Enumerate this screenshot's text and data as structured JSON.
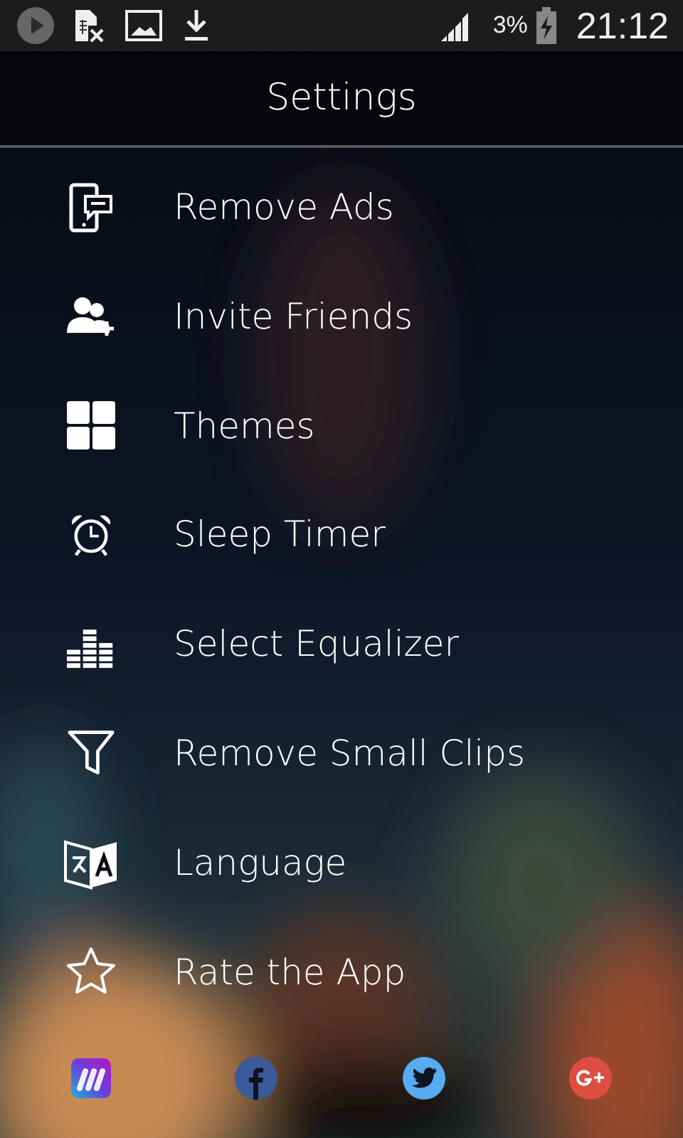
{
  "status_bar": {
    "battery": "3%",
    "time": "21:12"
  },
  "header": {
    "title": "Settings"
  },
  "menu": [
    {
      "kind": "ads",
      "label": "Remove Ads"
    },
    {
      "kind": "invite",
      "label": "Invite Friends"
    },
    {
      "kind": "themes",
      "label": "Themes"
    },
    {
      "kind": "timer",
      "label": "Sleep Timer"
    },
    {
      "kind": "equalizer",
      "label": "Select Equalizer"
    },
    {
      "kind": "filter",
      "label": "Remove Small Clips"
    },
    {
      "kind": "language",
      "label": "Language"
    },
    {
      "kind": "rate",
      "label": "Rate the App"
    }
  ],
  "footer": [
    {
      "kind": "app"
    },
    {
      "kind": "facebook"
    },
    {
      "kind": "twitter"
    },
    {
      "kind": "googleplus"
    }
  ]
}
